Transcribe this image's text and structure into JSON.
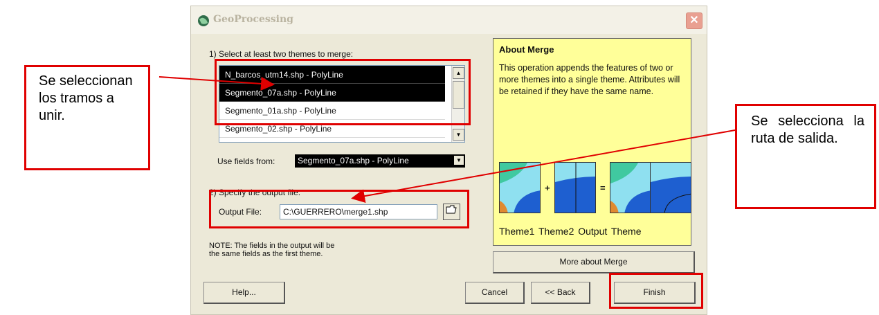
{
  "window": {
    "title": "GeoProcessing",
    "close": "✕"
  },
  "step1": {
    "label": "1) Select at least two themes to merge:"
  },
  "themes_list": [
    {
      "label": "N_barcos_utm14.shp - PolyLine",
      "selected": true
    },
    {
      "label": "Segmento_07a.shp - PolyLine",
      "selected": true
    },
    {
      "label": "Segmento_01a.shp - PolyLine",
      "selected": false
    },
    {
      "label": "Segmento_02.shp - PolyLine",
      "selected": false
    }
  ],
  "use_fields": {
    "label": "Use fields from:",
    "value": "Segmento_07a.shp - PolyLine"
  },
  "step2": {
    "label": "2) Specify the output file:"
  },
  "output": {
    "label": "Output File:",
    "value": "C:\\GUERRERO\\merge1.shp",
    "browse_icon": "folder-open-icon"
  },
  "note": "NOTE: The fields in the output will be\nthe same fields as the first theme.",
  "about": {
    "title": "About Merge",
    "text": "This operation appends the features of two or more themes into a single theme.  Attributes will be retained if they have the same name.",
    "plus": "+",
    "equals": "=",
    "theme_labels": "Theme1  Theme2  Output Theme"
  },
  "buttons": {
    "more": "More about Merge",
    "help": "Help...",
    "cancel": "Cancel",
    "back": "<< Back",
    "finish": "Finish"
  },
  "callouts": {
    "left": "Se seleccionan los tramos a unir.",
    "right": "Se selecciona la ruta de salida."
  },
  "colors": {
    "annotation": "#e00000",
    "about_bg": "#ffff99",
    "dialog_bg": "#ece9d8"
  }
}
